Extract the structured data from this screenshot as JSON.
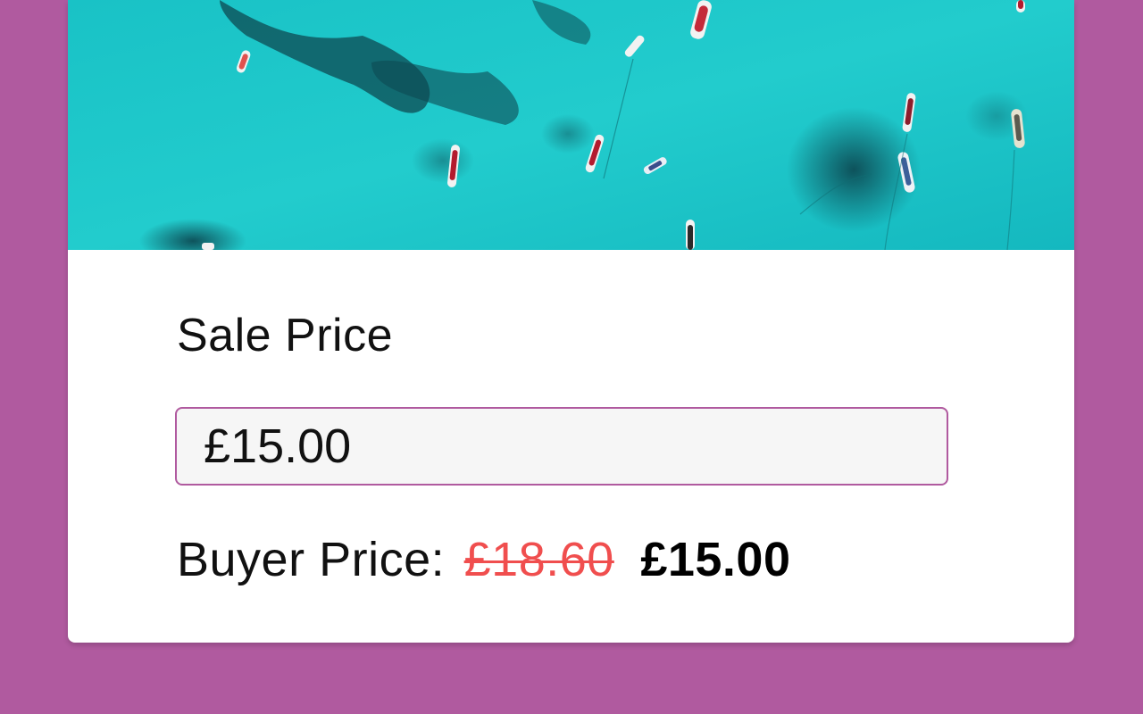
{
  "form": {
    "label": "Sale Price",
    "input_value": "£15.00"
  },
  "buyer": {
    "label": "Buyer Price:",
    "original_price": "£18.60",
    "sale_price": "£15.00"
  },
  "colors": {
    "background": "#b05a9f",
    "accent": "#b05a9f",
    "strike_price": "#f04e4e",
    "water": "#1fc6c8"
  }
}
